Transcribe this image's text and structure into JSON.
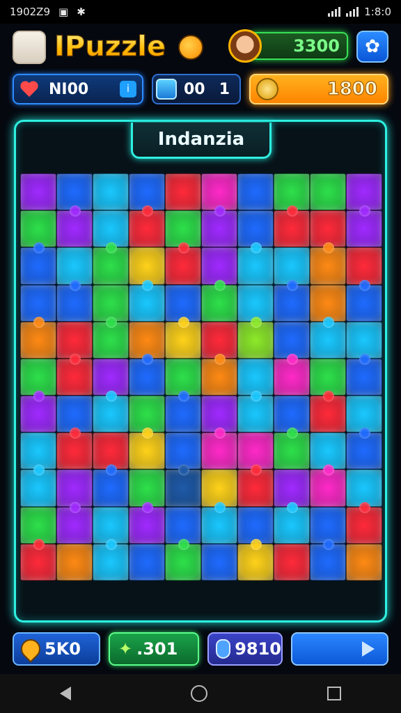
{
  "status_bar": {
    "time": "1902Z9",
    "clock": "1:8:0"
  },
  "header": {
    "title": "IPuzzle",
    "coins": "3300",
    "settings_icon": "gear-icon"
  },
  "stats": {
    "lives_value": "NI00",
    "boost_label": "00",
    "boost_count": "1",
    "gold": "1800"
  },
  "board": {
    "level_name": "Indanzia",
    "colors": {
      "r": "#ff2a3a",
      "o": "#ff8a14",
      "y": "#ffd21a",
      "g": "#2ee04a",
      "l": "#8eea2a",
      "c": "#1ac8ff",
      "b": "#1f6bff",
      "p": "#a02aff",
      "m": "#ff2ac8",
      "k": "#1f5aa8",
      "n": "#0d2a5a"
    },
    "rows": [
      "pbcbrmbggp",
      "gpcrgpbrrp",
      "bcgyrpccor",
      "bbgcbgcbob",
      "orgoyrlbcc",
      "grpbgocmgb",
      "pbcgbpcbrc",
      "crrybmmgcb",
      "cpbgkyrpmc",
      "gpcpbcbcbr",
      "rocbgbyrbo"
    ]
  },
  "bottom": {
    "btn1": "5K0",
    "btn2": ".301",
    "btn3": "9810"
  }
}
